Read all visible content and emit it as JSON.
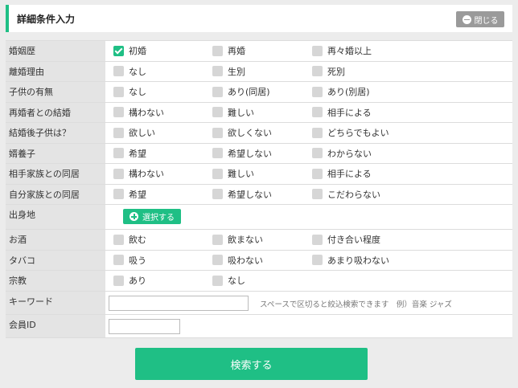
{
  "header": {
    "title": "詳細条件入力",
    "close_label": "閉じる"
  },
  "rows": [
    {
      "label": "婚姻歴",
      "options": [
        {
          "label": "初婚",
          "checked": true
        },
        {
          "label": "再婚",
          "checked": false
        },
        {
          "label": "再々婚以上",
          "checked": false
        }
      ]
    },
    {
      "label": "離婚理由",
      "options": [
        {
          "label": "なし",
          "checked": false
        },
        {
          "label": "生別",
          "checked": false
        },
        {
          "label": "死別",
          "checked": false
        }
      ]
    },
    {
      "label": "子供の有無",
      "options": [
        {
          "label": "なし",
          "checked": false
        },
        {
          "label": "あり(同居)",
          "checked": false
        },
        {
          "label": "あり(別居)",
          "checked": false
        }
      ]
    },
    {
      "label": "再婚者との結婚",
      "options": [
        {
          "label": "構わない",
          "checked": false
        },
        {
          "label": "難しい",
          "checked": false
        },
        {
          "label": "相手による",
          "checked": false
        }
      ]
    },
    {
      "label": "結婚後子供は？",
      "options": [
        {
          "label": "欲しい",
          "checked": false
        },
        {
          "label": "欲しくない",
          "checked": false
        },
        {
          "label": "どちらでもよい",
          "checked": false
        }
      ]
    },
    {
      "label": "婿養子",
      "options": [
        {
          "label": "希望",
          "checked": false
        },
        {
          "label": "希望しない",
          "checked": false
        },
        {
          "label": "わからない",
          "checked": false
        }
      ]
    },
    {
      "label": "相手家族との同居",
      "options": [
        {
          "label": "構わない",
          "checked": false
        },
        {
          "label": "難しい",
          "checked": false
        },
        {
          "label": "相手による",
          "checked": false
        }
      ]
    },
    {
      "label": "自分家族との同居",
      "options": [
        {
          "label": "希望",
          "checked": false
        },
        {
          "label": "希望しない",
          "checked": false
        },
        {
          "label": "こだわらない",
          "checked": false
        }
      ]
    }
  ],
  "birthplace": {
    "label": "出身地",
    "button_label": "選択する"
  },
  "rows2": [
    {
      "label": "お酒",
      "options": [
        {
          "label": "飲む",
          "checked": false
        },
        {
          "label": "飲まない",
          "checked": false
        },
        {
          "label": "付き合い程度",
          "checked": false
        }
      ]
    },
    {
      "label": "タバコ",
      "options": [
        {
          "label": "吸う",
          "checked": false
        },
        {
          "label": "吸わない",
          "checked": false
        },
        {
          "label": "あまり吸わない",
          "checked": false
        }
      ]
    },
    {
      "label": "宗教",
      "options": [
        {
          "label": "あり",
          "checked": false
        },
        {
          "label": "なし",
          "checked": false
        }
      ]
    }
  ],
  "keyword": {
    "label": "キーワード",
    "value": "",
    "hint": "スペースで区切ると絞込検索できます　例）音楽 ジャズ"
  },
  "member_id": {
    "label": "会員ID",
    "value": ""
  },
  "search_button_label": "検索する",
  "colors": {
    "accent": "#1fbf85",
    "label_bg": "#e4e4e4",
    "close_bg": "#9a9a9a"
  }
}
